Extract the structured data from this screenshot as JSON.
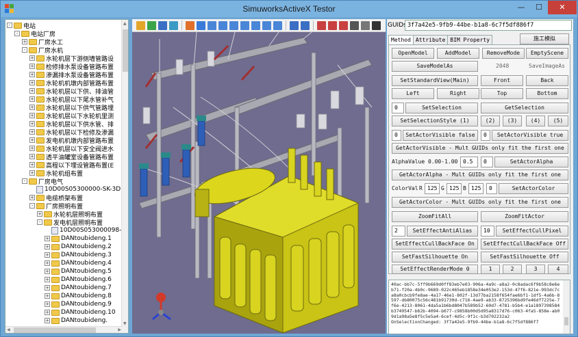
{
  "window": {
    "title": "SimuworksActiveX Testor",
    "min_glyph": "—",
    "max_glyph": "☐",
    "close_glyph": "✕"
  },
  "tree": {
    "items": [
      {
        "label": "电站",
        "indent": 0,
        "exp": "-",
        "kind": "folder"
      },
      {
        "label": "电站厂房",
        "indent": 1,
        "exp": "-",
        "kind": "folder"
      },
      {
        "label": "厂房水工",
        "indent": 2,
        "exp": "+",
        "kind": "folder"
      },
      {
        "label": "厂房水机",
        "indent": 2,
        "exp": "-",
        "kind": "folder"
      },
      {
        "label": "水轮机层下游侧墙管路设",
        "indent": 3,
        "exp": "+",
        "kind": "folder"
      },
      {
        "label": "检修排水泵设备管路布置",
        "indent": 3,
        "exp": "+",
        "kind": "folder"
      },
      {
        "label": "渗漏排水泵设备管路布置",
        "indent": 3,
        "exp": "+",
        "kind": "folder"
      },
      {
        "label": "水轮机机墩内部管路布置",
        "indent": 3,
        "exp": "+",
        "kind": "folder"
      },
      {
        "label": "水轮机层以下供、排油管",
        "indent": 3,
        "exp": "+",
        "kind": "folder"
      },
      {
        "label": "水轮机层以下尾水管补气",
        "indent": 3,
        "exp": "+",
        "kind": "folder"
      },
      {
        "label": "水轮机层以下供气管路埋",
        "indent": 3,
        "exp": "+",
        "kind": "folder"
      },
      {
        "label": "水轮机层以下水轮机里测",
        "indent": 3,
        "exp": "+",
        "kind": "folder"
      },
      {
        "label": "水轮机层以下供水管、排",
        "indent": 3,
        "exp": "+",
        "kind": "folder"
      },
      {
        "label": "水轮机层以下检修及渗漏",
        "indent": 3,
        "exp": "+",
        "kind": "folder"
      },
      {
        "label": "发电机机墩内部管路布置",
        "indent": 3,
        "exp": "+",
        "kind": "folder"
      },
      {
        "label": "水轮机层以下安全阀进水",
        "indent": 3,
        "exp": "+",
        "kind": "folder"
      },
      {
        "label": "透平油罐室设备管路布置",
        "indent": 3,
        "exp": "+",
        "kind": "folder"
      },
      {
        "label": "高程以下埋设管路布置(E",
        "indent": 3,
        "exp": "+",
        "kind": "folder"
      },
      {
        "label": "水轮机组布置",
        "indent": 3,
        "exp": "+",
        "kind": "folder"
      },
      {
        "label": "厂房电气",
        "indent": 2,
        "exp": "-",
        "kind": "folder"
      },
      {
        "label": "10D00S05300000-SK-3D.",
        "indent": 3,
        "exp": "",
        "kind": "doc"
      },
      {
        "label": "电缆桥架布置",
        "indent": 3,
        "exp": "+",
        "kind": "folder"
      },
      {
        "label": "厂房照明布置",
        "indent": 3,
        "exp": "-",
        "kind": "folder"
      },
      {
        "label": "水轮机层照明布置",
        "indent": 4,
        "exp": "+",
        "kind": "folder"
      },
      {
        "label": "发电机层照明布置",
        "indent": 4,
        "exp": "-",
        "kind": "folder"
      },
      {
        "label": "10D00S053000098-",
        "indent": 5,
        "exp": "",
        "kind": "doc"
      },
      {
        "label": "DANtoubideng.1",
        "indent": 5,
        "exp": "+",
        "kind": "folder"
      },
      {
        "label": "DANtoubideng.2",
        "indent": 5,
        "exp": "+",
        "kind": "folder"
      },
      {
        "label": "DANtoubideng.3",
        "indent": 5,
        "exp": "+",
        "kind": "folder"
      },
      {
        "label": "DANtoubideng.4",
        "indent": 5,
        "exp": "+",
        "kind": "folder"
      },
      {
        "label": "DANtoubideng.5",
        "indent": 5,
        "exp": "+",
        "kind": "folder"
      },
      {
        "label": "DANtoubideng.6",
        "indent": 5,
        "exp": "+",
        "kind": "folder"
      },
      {
        "label": "DANtoubideng.7",
        "indent": 5,
        "exp": "+",
        "kind": "folder"
      },
      {
        "label": "DANtoubideng.8",
        "indent": 5,
        "exp": "+",
        "kind": "folder"
      },
      {
        "label": "DANtoubideng.9",
        "indent": 5,
        "exp": "+",
        "kind": "folder"
      },
      {
        "label": "DANtoubideng.10",
        "indent": 5,
        "exp": "+",
        "kind": "folder"
      },
      {
        "label": "DANtoubideng.",
        "indent": 5,
        "exp": "+",
        "kind": "folder"
      }
    ]
  },
  "toolbar": {
    "icons": [
      {
        "name": "open-icon",
        "color": "#e4a62a"
      },
      {
        "name": "add-icon",
        "color": "#3aa44a"
      },
      {
        "name": "save-icon",
        "color": "#3a6fc4"
      },
      {
        "name": "export-icon",
        "color": "#3a9ac4"
      },
      {
        "name": "sep"
      },
      {
        "name": "select-icon",
        "color": "#e0702a"
      },
      {
        "name": "box-icon",
        "color": "#3a7ad8"
      },
      {
        "name": "front-view-icon",
        "color": "#4a86d8"
      },
      {
        "name": "back-view-icon",
        "color": "#4a86d8"
      },
      {
        "name": "left-view-icon",
        "color": "#4a86d8"
      },
      {
        "name": "right-view-icon",
        "color": "#4a86d8"
      },
      {
        "name": "top-view-icon",
        "color": "#4a86d8"
      },
      {
        "name": "bottom-view-icon",
        "color": "#4a86d8"
      },
      {
        "name": "iso-view-icon",
        "color": "#4a86d8"
      },
      {
        "name": "sep"
      },
      {
        "name": "zoom-fit-icon",
        "color": "#3a6fc4"
      },
      {
        "name": "zoom-icon",
        "color": "#3a6fc4"
      },
      {
        "name": "sep"
      },
      {
        "name": "axis-x-icon",
        "color": "#c84040"
      },
      {
        "name": "axis-y-icon",
        "color": "#c84040"
      },
      {
        "name": "axis-z-icon",
        "color": "#c84040"
      },
      {
        "name": "cube-icon",
        "color": "#555555"
      },
      {
        "name": "cube-wire-icon",
        "color": "#777777"
      },
      {
        "name": "cube-solid-icon",
        "color": "#333333"
      }
    ]
  },
  "panel": {
    "guid_label": "GUIDs",
    "guid_value": "3f7a42e5-9fb9-44be-b1a8-6c7f5df886f7",
    "tabs": [
      "Method",
      "Attribute",
      "BIM Property"
    ],
    "sim_button": "施工模拟",
    "row1": [
      "OpenModel",
      "AddModel",
      "RemoveMode",
      "EmptyScene"
    ],
    "save_model_as": "SaveModelAs",
    "img_size": "2048",
    "save_image_as": "SaveImageAs",
    "set_standard_view": "SetStandardView(Main)",
    "front": "Front",
    "back": "Back",
    "left": "Left",
    "right": "Right",
    "top": "Top",
    "bottom": "Bottom",
    "sel_input": "0",
    "set_selection": "SetSelection",
    "get_selection": "GetSelection",
    "set_selection_style": "SetSelectionStyle (1)",
    "style_2": "(2)",
    "style_3": "(3)",
    "style_4": "(4)",
    "style_5": "(5)",
    "vis_input1": "0",
    "set_actor_visible_false": "SetActorVisible false",
    "vis_input2": "0",
    "set_actor_visible_true": "SetActorVisible true",
    "get_actor_visible": "GetActorVisible - Mult GUIDs only fit the first one",
    "alpha_label": "AlphaValue 0.00-1.00",
    "alpha_value": "0.5",
    "alpha_input": "0",
    "set_actor_alpha": "SetActorAlpha",
    "get_actor_alpha": "GetActorAlpha - Mult GUIDs only fit the first one",
    "color_label": "ColorVal",
    "r_label": "R",
    "r_value": "125",
    "g_label": "G",
    "g_value": "125",
    "b_label": "B",
    "b_value": "125",
    "color_input": "0",
    "set_actor_color": "SetActorColor",
    "get_actor_color": "GetActorColor - Mult GUIDs only fit the first one",
    "zoom_fit_all": "ZoomFitAll",
    "zoom_fit_actor": "ZoomFitActor",
    "aa_input": "2",
    "set_effect_anti_alias": "SetEffectAntiAlias",
    "cull_input": "10",
    "set_effect_cull_pixel": "SetEffectCullPixel",
    "cull_back_on": "SetEffectCullBackFace On",
    "cull_back_off": "SetEffectCullBackFace Off",
    "fast_sil_on": "SetFastSilhouette On",
    "fast_sil_off": "SetFastSilhouette Off",
    "render_mode_0": "SetEffectRenderMode 0",
    "render_1": "1",
    "render_2": "2",
    "render_3": "3",
    "render_4": "4"
  },
  "log": {
    "text": "40ac-bb7c-5ff9b669d0ff83eb7e03-906a-4a9c-a8a2-0c8adac6f9b58c8e6eb71-f20a-4b0c-9689-022c465eb1858e34e053e2-153d-47f6-821e-993dc7ca8a0cbcb9fe8ae-4a17-46e1-802f-13d77ba2158f654fae6bf1-1df5-4a6b-8597-db80075c56c481b91730d-c716-4ae9-ab33-8725396bd9fe46df7225e-7f6e-4213-8061-4da5a1b6bd8047b589b52-60d7-4781-b5b4-e1a1897398584b3749547-b62b-4094-b677-c9858b00d5d95a8317d76-c063-4fa5-858e-ab09d1a98a5e8f5c5e5a4-6cef-4d5c-9f1c-b3d702232a2",
    "last_line": "OnSelectionChanged: 3f7a42e5-9fb9-44be-b1a8-6c7f5df886f7"
  }
}
